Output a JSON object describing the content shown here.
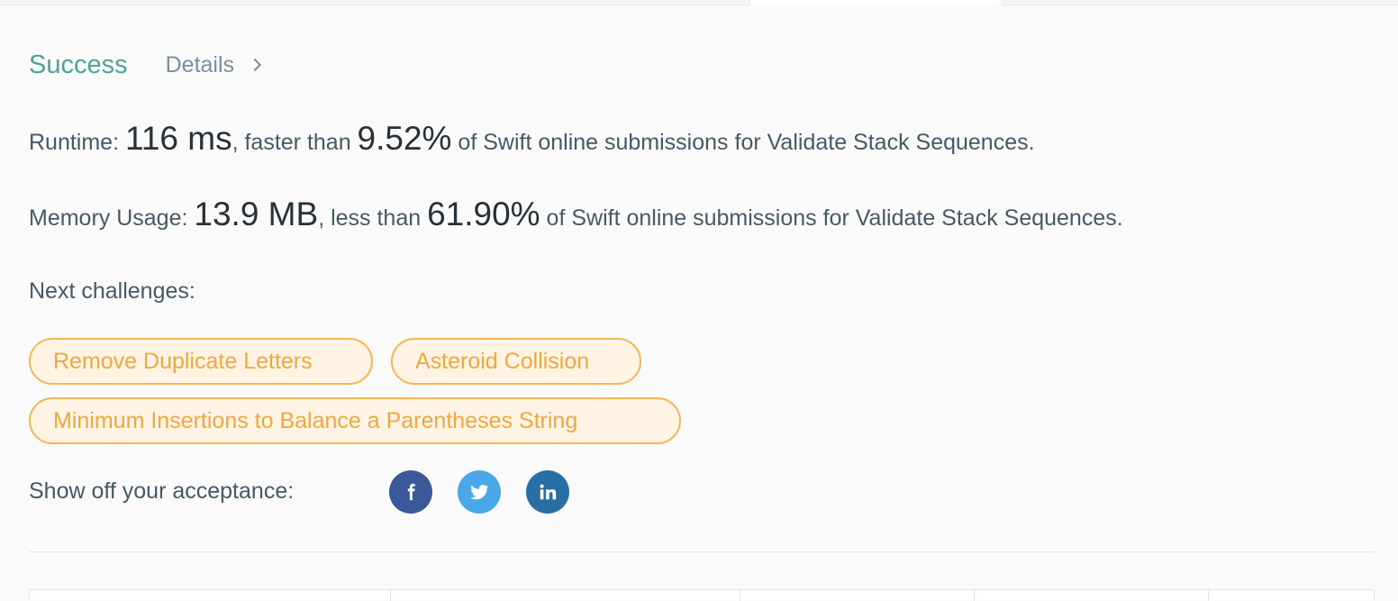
{
  "status": {
    "result": "Success",
    "details_label": "Details"
  },
  "runtime": {
    "label": "Runtime: ",
    "value": "116 ms",
    "comparator": ", faster than ",
    "percent": "9.52%",
    "suffix": " of Swift online submissions for Validate Stack Sequences."
  },
  "memory": {
    "label": "Memory Usage: ",
    "value": "13.9 MB",
    "comparator": ", less than ",
    "percent": "61.90%",
    "suffix": " of Swift online submissions for Validate Stack Sequences."
  },
  "next_challenges": {
    "label": "Next challenges:",
    "items": [
      "Remove Duplicate Letters",
      "Asteroid Collision",
      "Minimum Insertions to Balance a Parentheses String"
    ]
  },
  "share": {
    "label": "Show off your acceptance:",
    "icons": [
      "facebook-icon",
      "twitter-icon",
      "linkedin-icon"
    ]
  },
  "colors": {
    "success": "#4ea39a",
    "chip_border": "#f5b555",
    "chip_bg": "#fff4e3",
    "chip_text": "#f0a73f",
    "facebook": "#3b5998",
    "twitter": "#4aa8e8",
    "linkedin": "#276ea5"
  }
}
